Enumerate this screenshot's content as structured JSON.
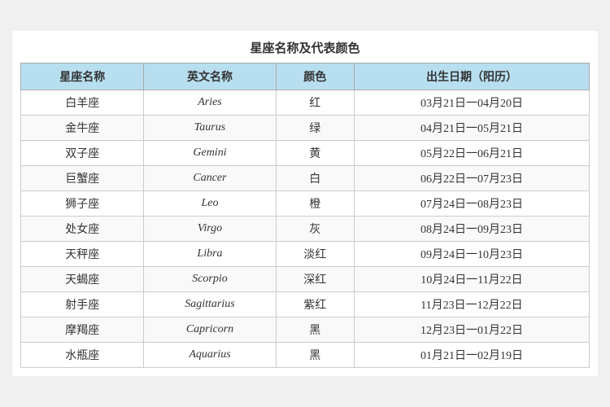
{
  "title": "星座名称及代表颜色",
  "table": {
    "headers": [
      "星座名称",
      "英文名称",
      "颜色",
      "出生日期（阳历）"
    ],
    "rows": [
      {
        "chinese": "白羊座",
        "english": "Aries",
        "color": "红",
        "dates": "03月21日一04月20日"
      },
      {
        "chinese": "金牛座",
        "english": "Taurus",
        "color": "绿",
        "dates": "04月21日一05月21日"
      },
      {
        "chinese": "双子座",
        "english": "Gemini",
        "color": "黄",
        "dates": "05月22日一06月21日"
      },
      {
        "chinese": "巨蟹座",
        "english": "Cancer",
        "color": "白",
        "dates": "06月22日一07月23日"
      },
      {
        "chinese": "狮子座",
        "english": "Leo",
        "color": "橙",
        "dates": "07月24日一08月23日"
      },
      {
        "chinese": "处女座",
        "english": "Virgo",
        "color": "灰",
        "dates": "08月24日一09月23日"
      },
      {
        "chinese": "天秤座",
        "english": "Libra",
        "color": "淡红",
        "dates": "09月24日一10月23日"
      },
      {
        "chinese": "天蝎座",
        "english": "Scorpio",
        "color": "深红",
        "dates": "10月24日一11月22日"
      },
      {
        "chinese": "射手座",
        "english": "Sagittarius",
        "color": "紫红",
        "dates": "11月23日一12月22日"
      },
      {
        "chinese": "摩羯座",
        "english": "Capricorn",
        "color": "黑",
        "dates": "12月23日一01月22日"
      },
      {
        "chinese": "水瓶座",
        "english": "Aquarius",
        "color": "黑",
        "dates": "01月21日一02月19日"
      }
    ]
  }
}
